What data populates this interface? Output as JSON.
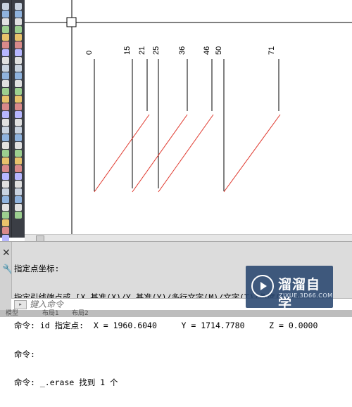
{
  "colors": {
    "toolbar_bg": "#3b3e45",
    "canvas_bg": "#ffffff",
    "leader_line": "#000000",
    "erased_line": "#e03a2f",
    "command_bg": "#dcdcdc"
  },
  "toolbar": {
    "left_icons": [
      "arc-icon",
      "circle-icon",
      "spline-icon",
      "ellipse-icon",
      "polyline-icon",
      "hatch-icon",
      "gradient-icon",
      "boundary-icon",
      "region-icon",
      "table-icon",
      "point-icon",
      "line-icon",
      "rectangle-icon",
      "polygon-icon",
      "revcloud-icon",
      "donut-icon",
      "block-icon",
      "text-icon",
      "multileader-icon",
      "dimension-icon",
      "align-icon",
      "array-icon",
      "attdef-icon",
      "insert-icon",
      "wipeout-icon",
      "group-icon",
      "layer-icon",
      "properties-icon",
      "orbit-icon",
      "view-icon",
      "erase-icon",
      "scroll-left-icon"
    ],
    "right_icons": [
      "copy-icon",
      "mirror-icon",
      "offset-icon",
      "move-icon",
      "rotate-icon",
      "scale-icon",
      "stretch-icon",
      "trim-icon",
      "extend-icon",
      "break-icon",
      "join-icon",
      "chamfer-icon",
      "fillet-icon",
      "explode-icon",
      "measure-icon",
      "divide-icon",
      "lengthen-icon",
      "edit-polyline-icon",
      "edit-spline-icon",
      "edit-hatch-icon",
      "match-icon",
      "purge-icon",
      "osnap-icon",
      "ortho-icon",
      "polar-icon",
      "lineweight-icon",
      "transparency-icon",
      "selection-icon"
    ]
  },
  "drawing": {
    "labels": [
      "0",
      "15",
      "21",
      "25",
      "36",
      "46",
      "50",
      "71"
    ]
  },
  "command": {
    "history": [
      "指定点坐标:",
      "指定引线端点或 [X 基准(X)/Y 基准(Y)/多行文字(M)/文字(T)/角度(A)]:",
      "命令: id 指定点:  X = 1960.6040     Y = 1714.7780     Z = 0.0000",
      "命令:",
      "命令: _.erase 找到 1 个"
    ],
    "input_placeholder": "键入命令"
  },
  "layout_tabs": [
    "模型",
    "布局1",
    "布局2"
  ],
  "watermark": {
    "brand": "溜溜自学",
    "url": "ZIXUE.3D66.COM"
  }
}
